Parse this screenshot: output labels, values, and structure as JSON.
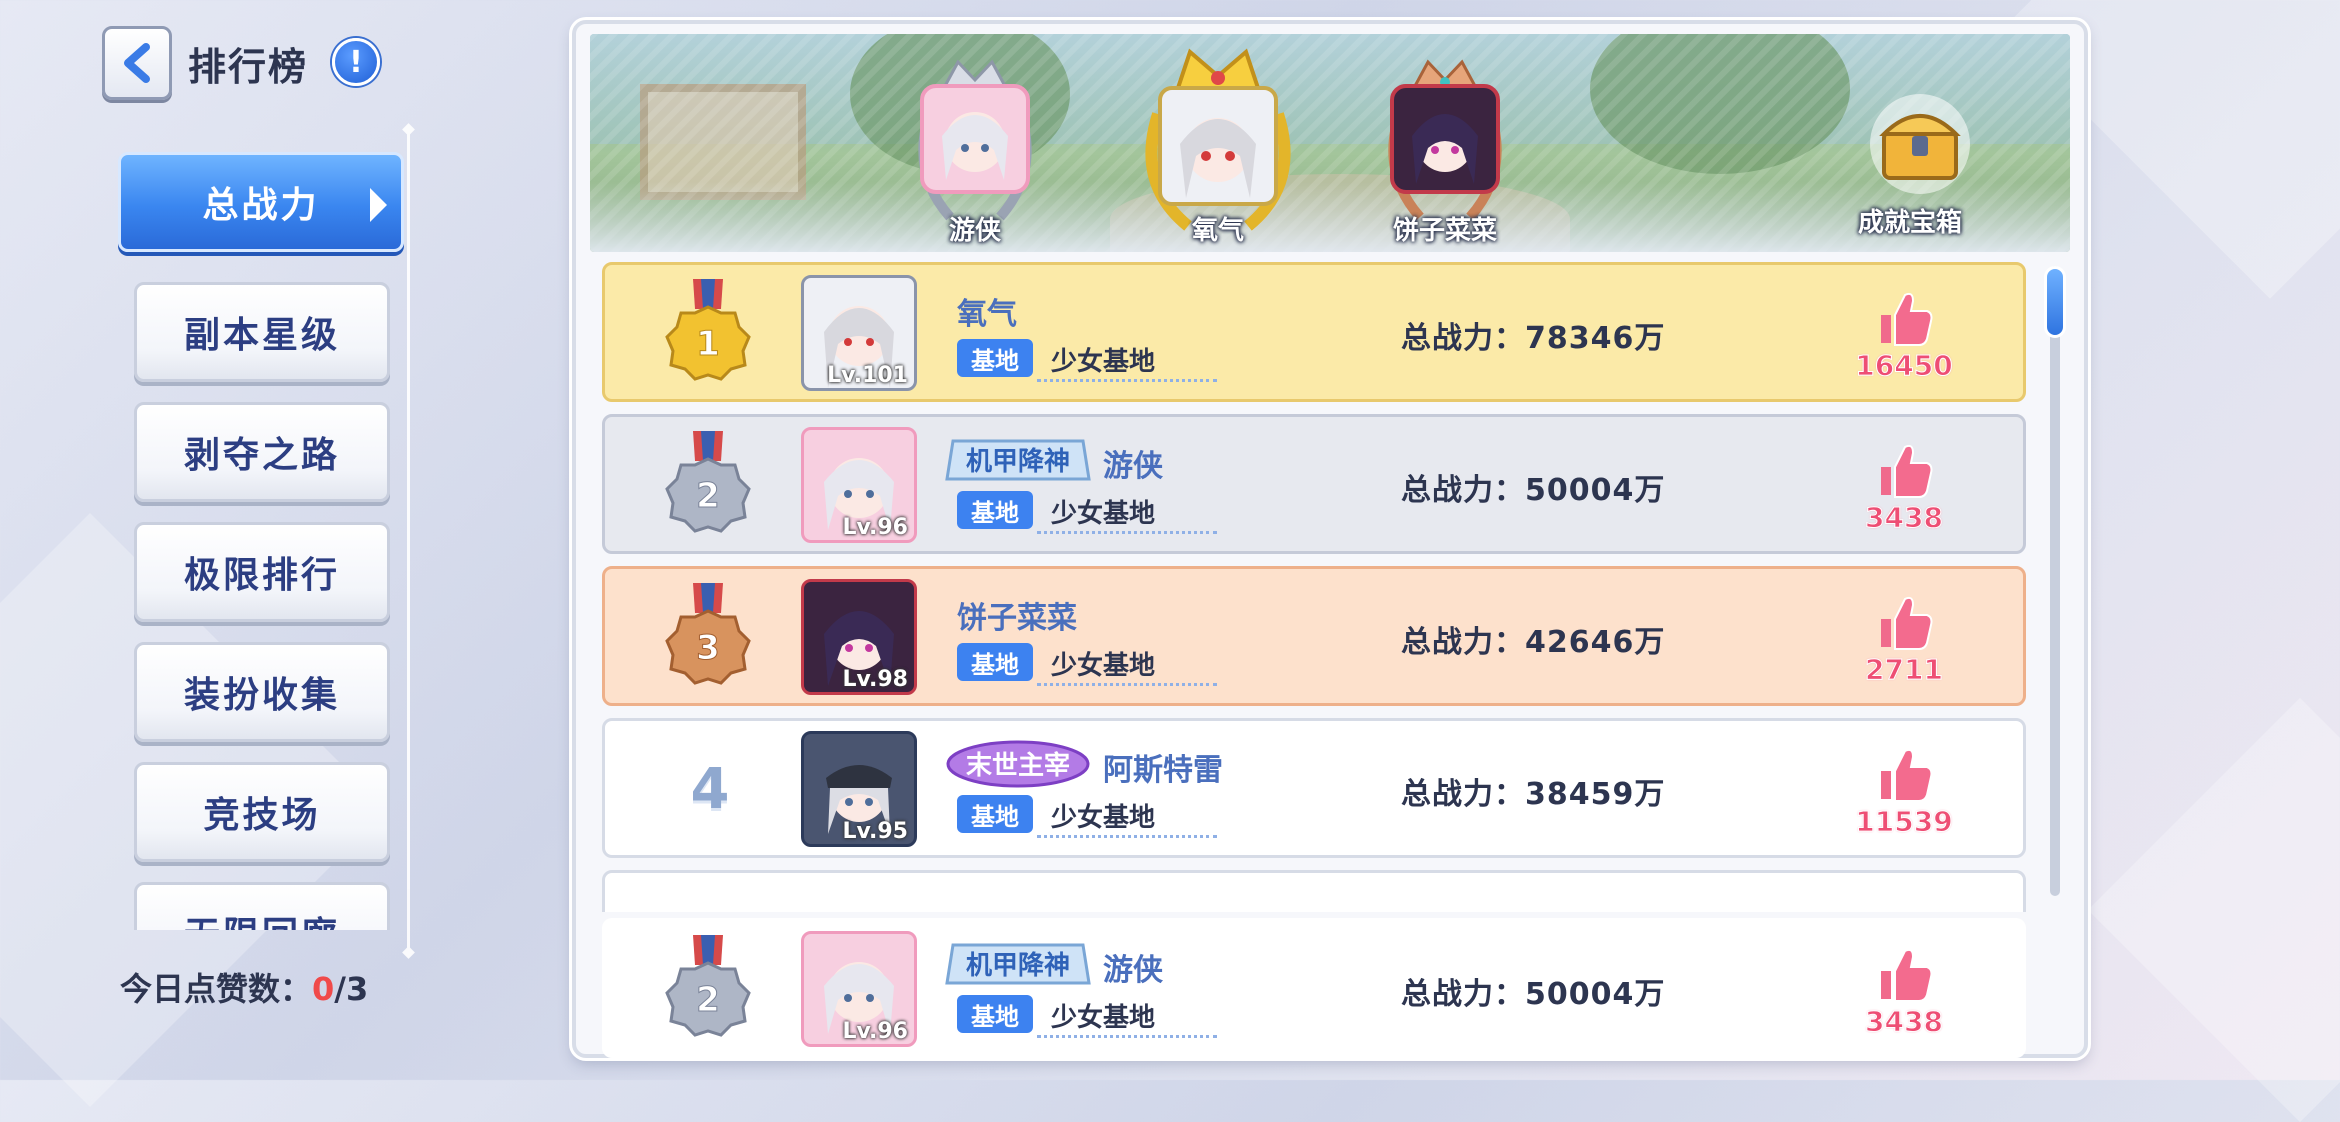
{
  "header": {
    "title": "排行榜",
    "info": "!"
  },
  "sidebar": {
    "items": [
      {
        "label": "总战力"
      },
      {
        "label": "副本星级"
      },
      {
        "label": "剥夺之路"
      },
      {
        "label": "极限排行"
      },
      {
        "label": "装扮收集"
      },
      {
        "label": "竞技场"
      },
      {
        "label": "无限回廊"
      }
    ],
    "active_index": 0
  },
  "daily_likes": {
    "label": "今日点赞数：",
    "used": "0",
    "total": "/3"
  },
  "podium": {
    "first": {
      "name": "氧气"
    },
    "second": {
      "name": "游侠"
    },
    "third": {
      "name": "饼子菜菜"
    },
    "chest_label": "成就宝箱"
  },
  "power_prefix": "总战力：",
  "rankings": [
    {
      "rank": "1",
      "name": "氧气",
      "level": "Lv.101",
      "guild_tag": "基地",
      "guild": "少女基地",
      "power": "总战力：78346万",
      "likes": "16450",
      "title_badge": ""
    },
    {
      "rank": "2",
      "name": "游侠",
      "level": "Lv.96",
      "guild_tag": "基地",
      "guild": "少女基地",
      "power": "总战力：50004万",
      "likes": "3438",
      "title_badge": "机甲降神"
    },
    {
      "rank": "3",
      "name": "饼子菜菜",
      "level": "Lv.98",
      "guild_tag": "基地",
      "guild": "少女基地",
      "power": "总战力：42646万",
      "likes": "2711",
      "title_badge": ""
    },
    {
      "rank": "4",
      "name": "阿斯特雷",
      "level": "Lv.95",
      "guild_tag": "基地",
      "guild": "少女基地",
      "power": "总战力：38459万",
      "likes": "11539",
      "title_badge": "末世主宰"
    }
  ],
  "my_rank": {
    "rank": "2",
    "name": "游侠",
    "level": "Lv.96",
    "guild_tag": "基地",
    "guild": "少女基地",
    "power": "总战力：50004万",
    "likes": "3438",
    "title_badge": "机甲降神"
  },
  "colors": {
    "accent_blue": "#3a86f0",
    "like_pink": "#ee4e74",
    "gold": "#f2c230",
    "silver": "#aeb6c6",
    "bronze": "#d8935e"
  }
}
